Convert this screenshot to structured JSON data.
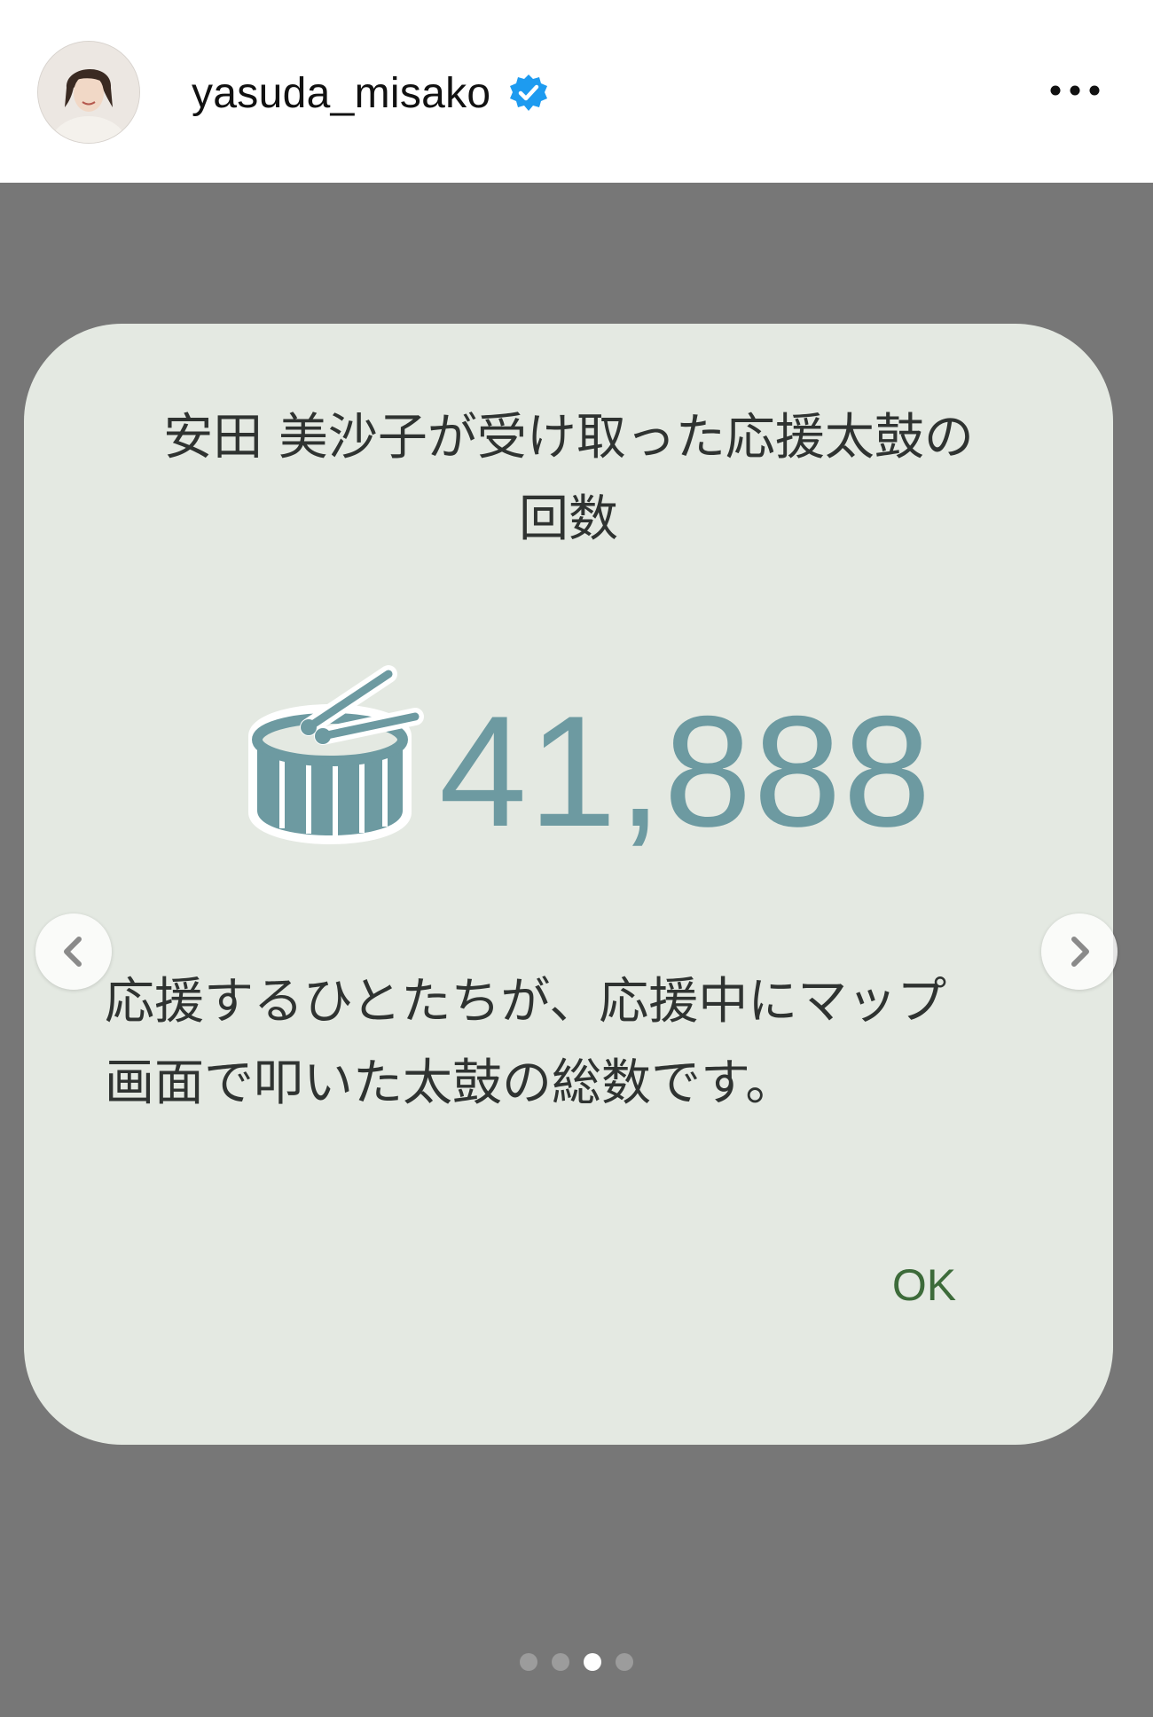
{
  "header": {
    "username": "yasuda_misako",
    "verified": true,
    "more_icon": "more-horizontal-icon"
  },
  "dialog": {
    "title_line1": "安田 美沙子が受け取った応援太鼓の",
    "title_line2": "回数",
    "icon": "drum-icon",
    "count": "41,888",
    "description_line1": "応援するひとたちが、応援中にマップ",
    "description_line2": "画面で叩いた太鼓の総数です。",
    "ok_label": "OK"
  },
  "carousel": {
    "prev_icon": "chevron-left-icon",
    "next_icon": "chevron-right-icon",
    "total_slides": 4,
    "active_slide": 3
  },
  "colors": {
    "accent_count": "#6d9aa1",
    "ok_text": "#3d6b3a",
    "card_bg": "#e4e9e2",
    "overlay_bg": "#777777",
    "verified_badge": "#1d9bf0"
  }
}
